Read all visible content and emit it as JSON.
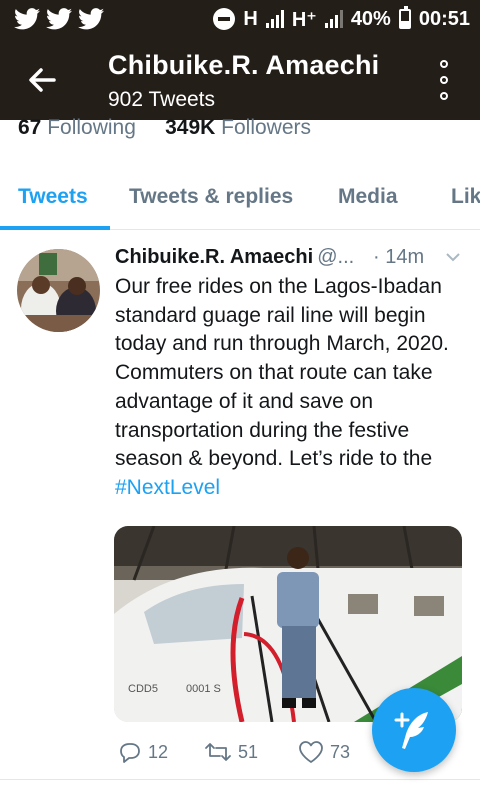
{
  "status_bar": {
    "notification_icons": [
      "twitter-bird-icon",
      "twitter-bird-icon",
      "twitter-bird-icon"
    ],
    "network_1": "H",
    "network_2": "H⁺",
    "battery": "40%",
    "time": "00:51"
  },
  "header": {
    "title": "Chibuike.R. Amaechi",
    "subtitle": "902 Tweets"
  },
  "profile": {
    "following_count": "67",
    "following_label": "Following",
    "followers_count": "349K",
    "followers_label": "Followers"
  },
  "tabs": [
    {
      "label": "Tweets",
      "active": true
    },
    {
      "label": "Tweets & replies",
      "active": false
    },
    {
      "label": "Media",
      "active": false
    },
    {
      "label": "Lik",
      "active": false
    }
  ],
  "tweet": {
    "author": "Chibuike.R. Amaechi",
    "handle": "@...",
    "time": "· 14m",
    "text": "Our free rides on the Lagos-Ibadan standard guage rail line will begin today and run through March, 2020. Commuters on that route can take advantage of it and save on transportation during the festive season & beyond. Let’s ride to the ",
    "hashtag": "#NextLevel",
    "train_text": "CDD5",
    "train_text_2": "0001 S",
    "replies": "12",
    "retweets": "51",
    "likes": "73"
  },
  "colors": {
    "header_bg": "#241e18",
    "accent": "#1da1f2",
    "secondary_text": "#657786"
  }
}
